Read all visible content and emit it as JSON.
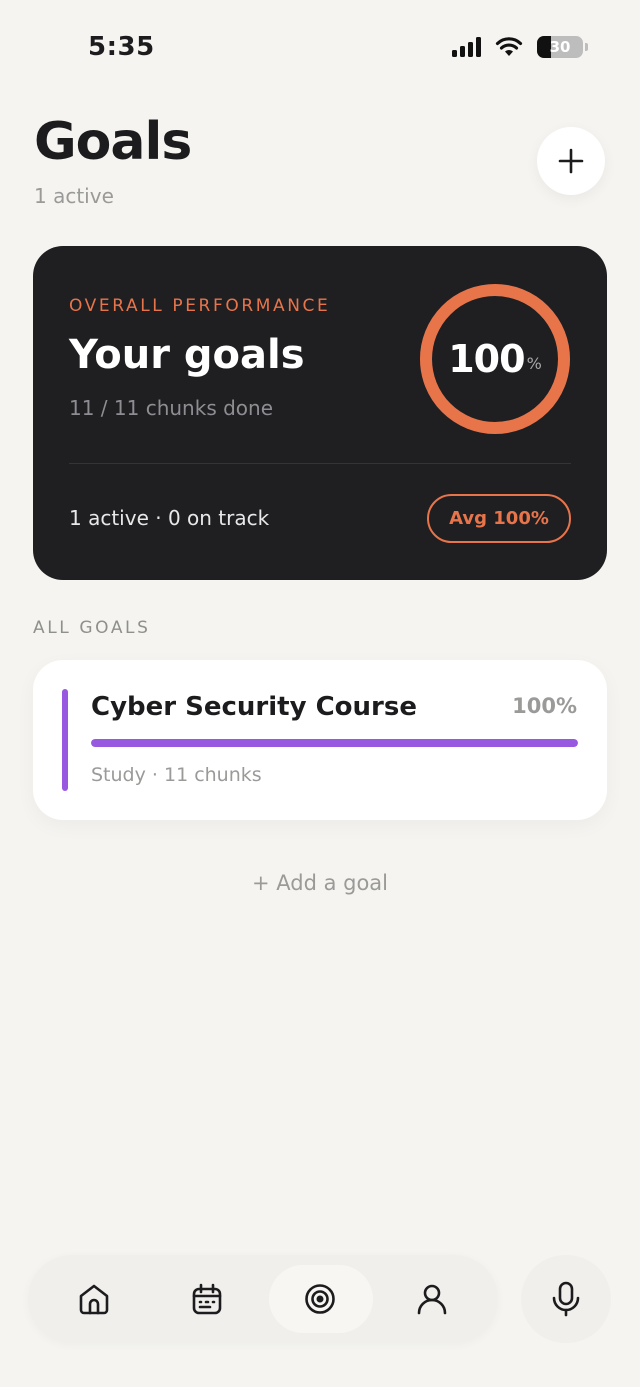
{
  "status_bar": {
    "time": "5:35",
    "battery": "30",
    "battery_level": 0.3
  },
  "header": {
    "title": "Goals",
    "subtitle": "1 active"
  },
  "performance": {
    "label": "OVERALL PERFORMANCE",
    "title": "Your goals",
    "subtitle": "11 / 11 chunks done",
    "ring_value": "100",
    "ring_unit": "%",
    "ring_progress": 1.0,
    "stats": "1 active · 0 on track",
    "avg_label": "Avg 100%"
  },
  "section_label": "ALL GOALS",
  "goals": [
    {
      "name": "Cyber Security Course",
      "percent_label": "100%",
      "progress": 1.0,
      "meta": "Study · 11 chunks"
    }
  ],
  "add_goal_label": "+ Add a goal",
  "nav": {
    "items": [
      {
        "id": "home",
        "icon": "home-icon"
      },
      {
        "id": "calendar",
        "icon": "calendar-icon"
      },
      {
        "id": "goals",
        "icon": "target-icon",
        "active": true
      },
      {
        "id": "profile",
        "icon": "user-icon"
      }
    ],
    "mic_icon": "microphone-icon"
  },
  "colors": {
    "background": "#f5f4f0",
    "card_dark": "#1f1f22",
    "accent_orange": "#e8744a",
    "accent_purple": "#9859e0",
    "muted_text": "#9a9a98"
  }
}
